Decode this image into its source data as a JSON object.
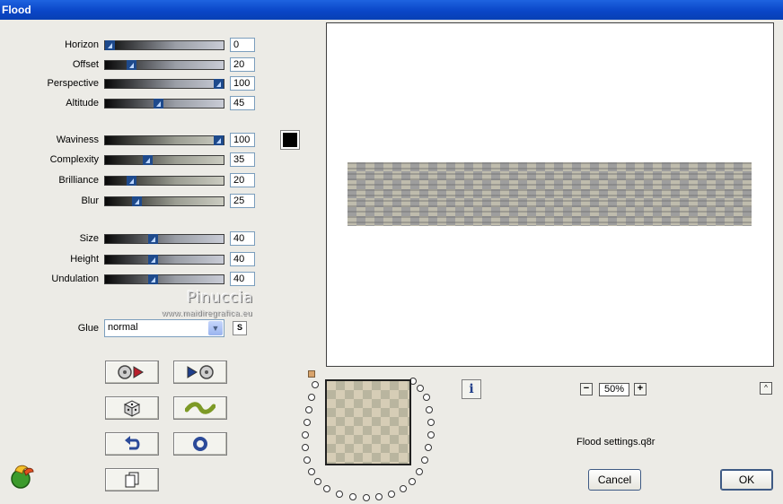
{
  "window": {
    "title": "Flood"
  },
  "sliders": [
    {
      "id": "horizon",
      "label": "Horizon",
      "value": "0",
      "level": 0.0,
      "track": "cool"
    },
    {
      "id": "offset",
      "label": "Offset",
      "value": "20",
      "level": 0.2,
      "track": "cool"
    },
    {
      "id": "perspective",
      "label": "Perspective",
      "value": "100",
      "level": 1.0,
      "track": "cool"
    },
    {
      "id": "altitude",
      "label": "Altitude",
      "value": "45",
      "level": 0.45,
      "track": "cool"
    },
    {
      "id": "waviness",
      "label": "Waviness",
      "value": "100",
      "level": 1.0,
      "track": "warm"
    },
    {
      "id": "complexity",
      "label": "Complexity",
      "value": "35",
      "level": 0.35,
      "track": "warm"
    },
    {
      "id": "brilliance",
      "label": "Brilliance",
      "value": "20",
      "level": 0.2,
      "track": "warm"
    },
    {
      "id": "blur",
      "label": "Blur",
      "value": "25",
      "level": 0.25,
      "track": "warm"
    },
    {
      "id": "size",
      "label": "Size",
      "value": "40",
      "level": 0.4,
      "track": "cool"
    },
    {
      "id": "height",
      "label": "Height",
      "value": "40",
      "level": 0.4,
      "track": "cool"
    },
    {
      "id": "undulation",
      "label": "Undulation",
      "value": "40",
      "level": 0.4,
      "track": "cool"
    }
  ],
  "color_swatch": {
    "color": "#000000"
  },
  "watermark": {
    "name": "Pinuccia",
    "url": "www.maidiregrafica.eu"
  },
  "glue": {
    "label": "Glue",
    "value": "normal",
    "button": "S"
  },
  "tool_buttons": [
    {
      "id": "open-preset",
      "icon": "disc-arrow-icon"
    },
    {
      "id": "save-preset",
      "icon": "arrow-disc-icon"
    },
    {
      "id": "randomize",
      "icon": "dice-icon"
    },
    {
      "id": "wave",
      "icon": "wave-icon"
    },
    {
      "id": "reset",
      "icon": "undo-arrow-icon"
    },
    {
      "id": "options",
      "icon": "ring-icon"
    },
    {
      "id": "copy",
      "icon": "copy-pages-icon"
    }
  ],
  "preview": {
    "zoom": "50%",
    "zoom_out": "−",
    "zoom_in": "+",
    "collapse": "^",
    "info": "i"
  },
  "settings_file": "Flood settings.q8r",
  "buttons": {
    "cancel": "Cancel",
    "ok": "OK"
  }
}
